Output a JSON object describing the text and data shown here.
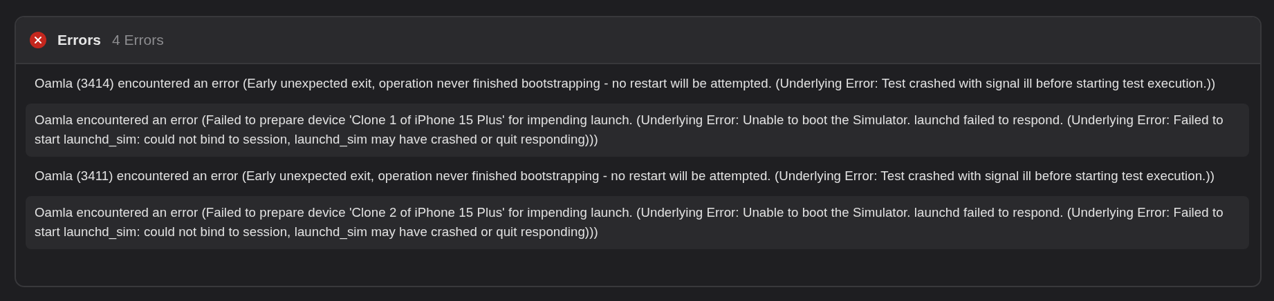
{
  "panel": {
    "title": "Errors",
    "count": "4 Errors"
  },
  "errors": [
    {
      "message": "Oamla (3414) encountered an error (Early unexpected exit, operation never finished bootstrapping - no restart will be attempted. (Underlying Error: Test crashed with signal ill before starting test execution.))"
    },
    {
      "message": "Oamla encountered an error (Failed to prepare device 'Clone 1 of iPhone 15 Plus' for impending launch. (Underlying Error: Unable to boot the Simulator. launchd failed to respond. (Underlying Error: Failed to start launchd_sim: could not bind to session, launchd_sim may have crashed or quit responding)))"
    },
    {
      "message": "Oamla (3411) encountered an error (Early unexpected exit, operation never finished bootstrapping - no restart will be attempted. (Underlying Error: Test crashed with signal ill before starting test execution.))"
    },
    {
      "message": "Oamla encountered an error (Failed to prepare device 'Clone 2 of iPhone 15 Plus' for impending launch. (Underlying Error: Unable to boot the Simulator. launchd failed to respond. (Underlying Error: Failed to start launchd_sim: could not bind to session, launchd_sim may have crashed or quit responding)))"
    }
  ]
}
